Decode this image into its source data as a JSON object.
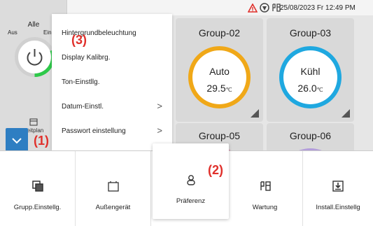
{
  "status": {
    "datetime": "25/08/2023 Fr 12:49 PM",
    "icons": [
      "warning-icon",
      "shield-icon",
      "tool-icon"
    ],
    "warning_color": "#e0302b"
  },
  "all_panel": {
    "title": "Alle",
    "off_label": "Aus",
    "on_label": "Ein",
    "schedule_label": "Zeitplan",
    "ring_color": "#2ec94a"
  },
  "menu": {
    "items": [
      {
        "label": "Hintergrundbeleuchtung",
        "has_chevron": false
      },
      {
        "label": "Display Kalibrg.",
        "has_chevron": false
      },
      {
        "label": "Ton-Einstllg.",
        "has_chevron": false
      },
      {
        "label": "Datum-Einstl.",
        "has_chevron": true
      },
      {
        "label": "Passwort einstellung",
        "has_chevron": true
      }
    ],
    "chevron": ">"
  },
  "groups": [
    {
      "name": "Group-02",
      "mode": "Auto",
      "temp": "29.5",
      "unit": "℃",
      "color": "#f0a818"
    },
    {
      "name": "Group-03",
      "mode": "Kühl",
      "temp": "26.0",
      "unit": "℃",
      "color": "#1fa8e0"
    }
  ],
  "groups_row2": [
    {
      "name": "Group-05",
      "color": "#e56aa0"
    },
    {
      "name": "Group-06",
      "color": "#b39ddb"
    }
  ],
  "annotations": {
    "a1": "(1)",
    "a2": "(2)",
    "a3": "(3)",
    "color": "#e0302b"
  },
  "bottom_nav": [
    {
      "label": "Grupp.Einstellg.",
      "icon": "group-settings-icon"
    },
    {
      "label": "Außengerät",
      "icon": "outdoor-unit-icon"
    },
    {
      "label": "Präferenz",
      "icon": "preference-icon",
      "active": true
    },
    {
      "label": "Wartung",
      "icon": "maintenance-icon"
    },
    {
      "label": "Install.Einstellg",
      "icon": "install-settings-icon"
    }
  ],
  "accent": "#2e7ec2"
}
